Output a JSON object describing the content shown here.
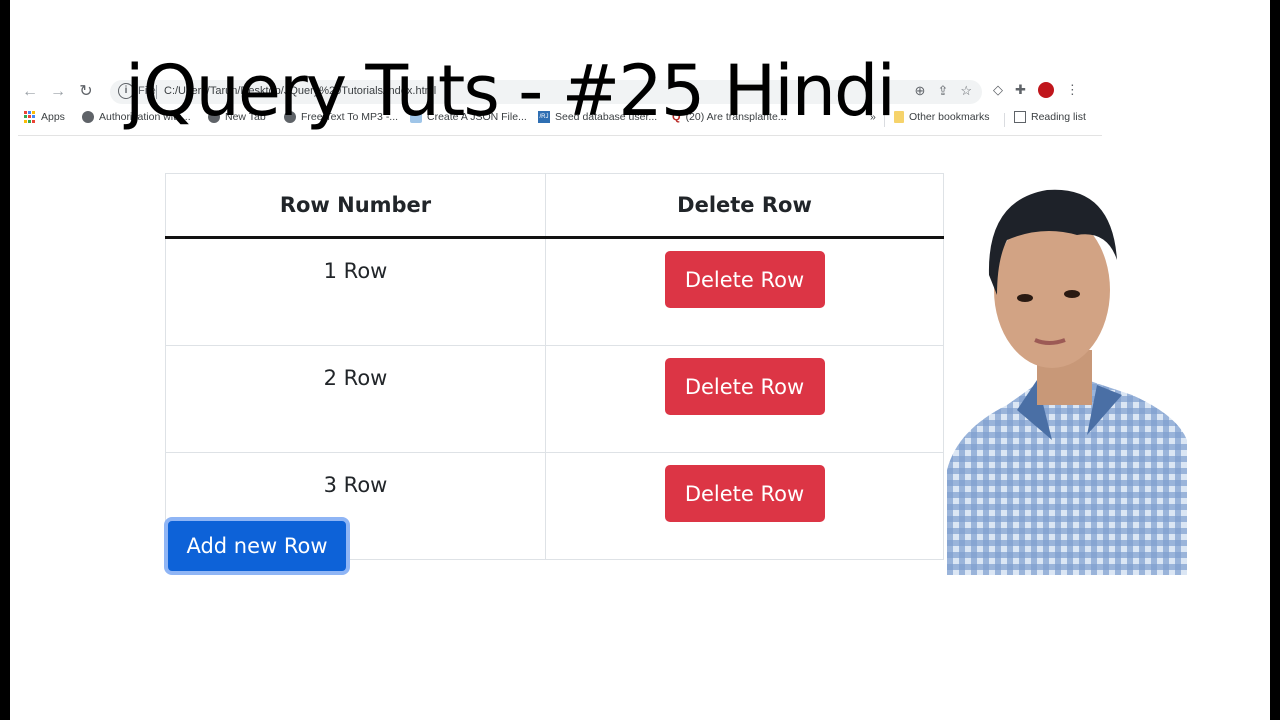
{
  "video_title": "jQuery Tuts - #25 Hindi",
  "browser": {
    "omnibox": {
      "scheme": "File",
      "url": "C:/Users/Tarun/Desktop/JQuery%20Tutorials/index.html"
    },
    "nav_icons": [
      "back-arrow-icon",
      "forward-arrow-icon",
      "reload-icon"
    ],
    "omnibox_actions": [
      "zoom-icon",
      "share-icon",
      "bookmark-star-icon"
    ],
    "toolbar_icons": [
      "tag-icon",
      "extensions-puzzle-icon",
      "profile-avatar-icon",
      "menu-kebab-icon"
    ],
    "bookmarks": [
      {
        "label": "Apps",
        "icon": "apps-grid-icon"
      },
      {
        "label": "Authorization with...",
        "icon": "globe-icon"
      },
      {
        "label": "New Tab",
        "icon": "globe-icon"
      },
      {
        "label": "Free Text To MP3 -...",
        "icon": "globe-icon"
      },
      {
        "label": "Create A JSON File...",
        "icon": "site-icon"
      },
      {
        "label": "Seed database user...",
        "icon": "rj-icon"
      },
      {
        "label": "(20) Are transplante...",
        "icon": "quora-icon"
      }
    ],
    "overflow_label": "»",
    "other_bookmarks": "Other bookmarks",
    "reading_list": "Reading list"
  },
  "table": {
    "headers": [
      "Row Number",
      "Delete Row"
    ],
    "rows": [
      {
        "label": "1 Row",
        "action": "Delete Row"
      },
      {
        "label": "2 Row",
        "action": "Delete Row"
      },
      {
        "label": "3 Row",
        "action": "Delete Row"
      }
    ]
  },
  "add_button_label": "Add new Row",
  "colors": {
    "delete_button": "#dc3545",
    "add_button": "#0d62d8",
    "add_button_focus_ring": "#8fb5f5"
  }
}
